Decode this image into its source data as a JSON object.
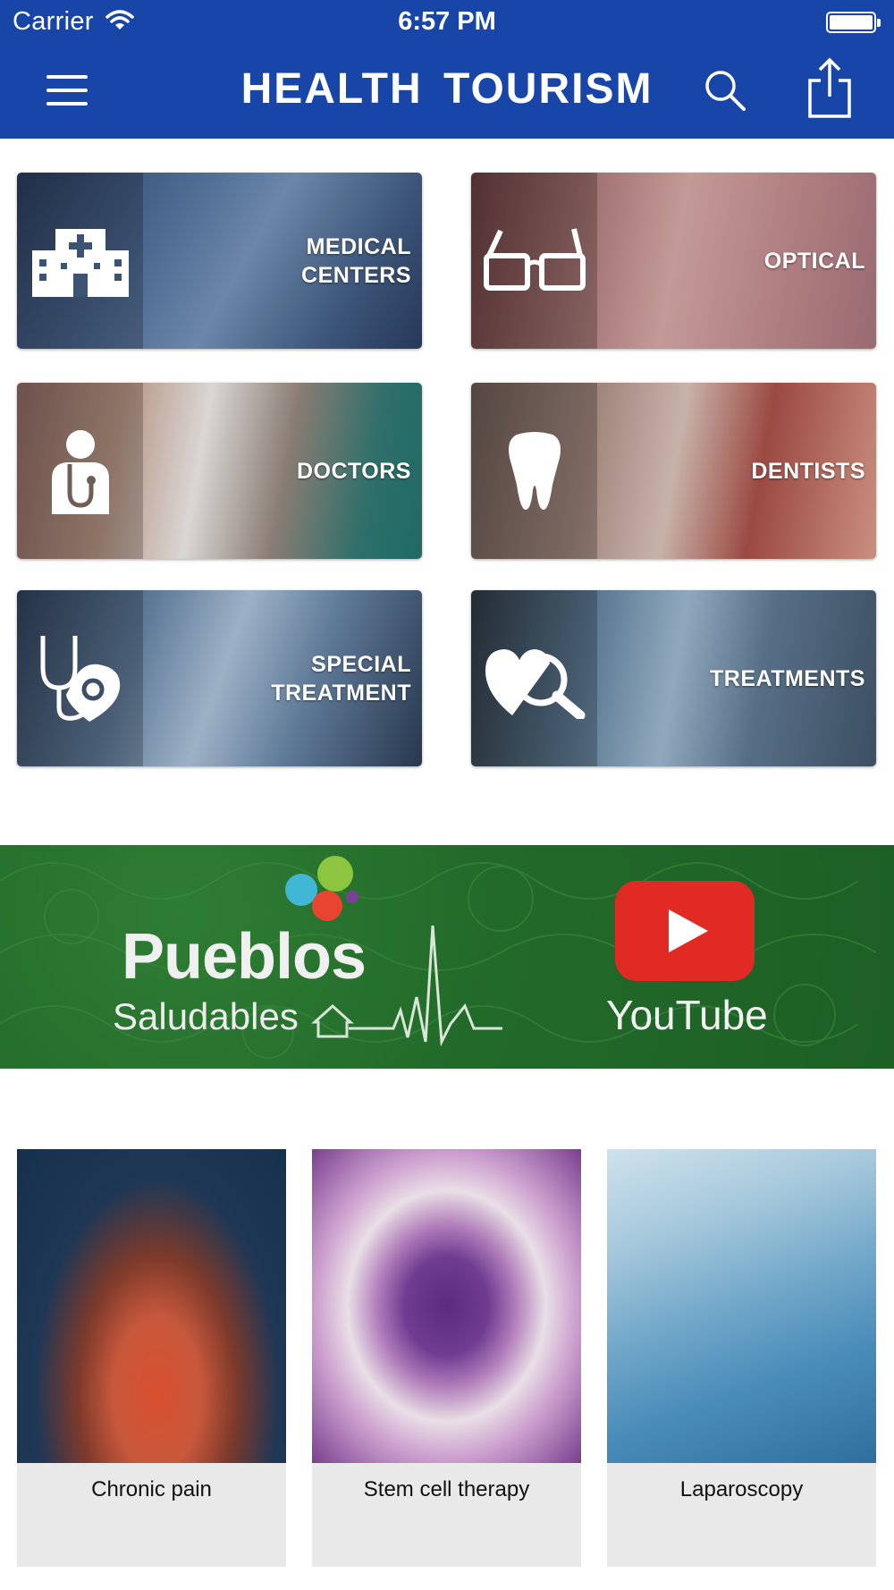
{
  "status_bar": {
    "carrier": "Carrier",
    "time": "6:57 PM"
  },
  "nav": {
    "title": "HEALTH TOURISM",
    "icons": [
      "menu-icon",
      "search-icon",
      "share-icon"
    ]
  },
  "tiles": [
    {
      "label": "MEDICAL\nCENTERS",
      "icon": "hospital-icon"
    },
    {
      "label": "OPTICAL",
      "icon": "glasses-icon"
    },
    {
      "label": "DOCTORS",
      "icon": "doctor-icon"
    },
    {
      "label": "DENTISTS",
      "icon": "tooth-icon"
    },
    {
      "label": "SPECIAL\nTREATMENT",
      "icon": "stethoscope-heart-icon"
    },
    {
      "label": "TREATMENTS",
      "icon": "heart-search-icon"
    }
  ],
  "banner": {
    "brand_title": "Pueblos",
    "brand_subtitle": "Saludables",
    "video_label": "YouTube",
    "colors": {
      "background": "#236b2a",
      "youtube": "#e12a24"
    }
  },
  "cards": [
    {
      "label": "Chronic pain"
    },
    {
      "label": "Stem cell therapy"
    },
    {
      "label": "Laparoscopy"
    }
  ],
  "colors": {
    "nav_bar": "#1846a8",
    "card_background": "#e9e9e9"
  }
}
